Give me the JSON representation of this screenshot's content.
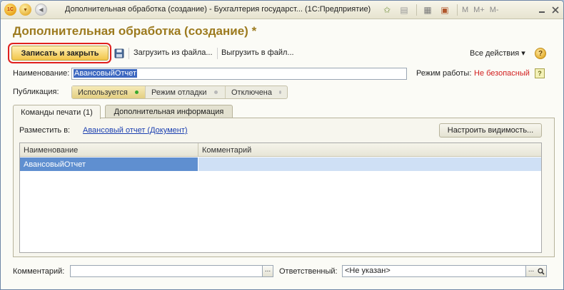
{
  "window": {
    "title": "Дополнительная обработка (создание) - Бухгалтерия государст...  (1С:Предприятие)",
    "tools": {
      "m1": "M",
      "m2": "M+",
      "m3": "M-"
    },
    "icons": [
      "1c-logo-icon",
      "main-menu-icon",
      "back-icon",
      "add-favorite-icon",
      "history-icon",
      "calculator-icon",
      "calendar-icon",
      "minimize-icon",
      "close-icon"
    ]
  },
  "header": {
    "title": "Дополнительная обработка (создание) *"
  },
  "toolbar": {
    "save_close": "Записать и закрыть",
    "load_file": "Загрузить из файла...",
    "unload_file": "Выгрузить в файл...",
    "all_actions": "Все действия ▾",
    "help": "?"
  },
  "form": {
    "name_label": "Наименование:",
    "name_value": "АвансовыйОтчет",
    "mode_label": "Режим работы:",
    "mode_value": "Не безопасный",
    "mode_help": "?",
    "publication_label": "Публикация:",
    "publication_options": [
      "Используется",
      "Режим отладки",
      "Отключена"
    ]
  },
  "tabs": {
    "print_commands": "Команды печати (1)",
    "extra_info": "Дополнительная информация"
  },
  "print_panel": {
    "place_label": "Разместить в:",
    "place_link": "Авансовый отчет (Документ)",
    "visibility_button": "Настроить видимость...",
    "columns": {
      "name": "Наименование",
      "comment": "Комментарий"
    },
    "rows": [
      {
        "name": "АвансовыйОтчет",
        "comment": ""
      }
    ]
  },
  "footer": {
    "comment_label": "Комментарий:",
    "comment_value": "",
    "dots": "...",
    "responsible_label": "Ответственный:",
    "responsible_value": "<Не указан>"
  },
  "colors": {
    "accent_gold": "#9c7a1e",
    "primary_button": "#f2c548",
    "highlight_ring": "#e0201e",
    "unsafe_mode": "#d21f1f",
    "selection": "#5f8fd0",
    "link": "#1b3fb0"
  }
}
